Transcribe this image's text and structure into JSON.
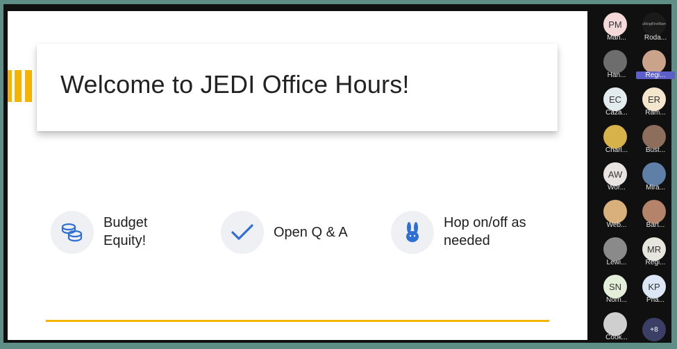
{
  "slide": {
    "title": "Welcome to JEDI Office Hours!",
    "features": [
      {
        "icon": "coins-icon",
        "label_line1": "Budget",
        "label_line2": "Equity!"
      },
      {
        "icon": "checkmark-icon",
        "label": "Open Q & A"
      },
      {
        "icon": "bunny-icon",
        "label_line1": "Hop on/off as",
        "label_line2": "needed"
      }
    ]
  },
  "participants": [
    {
      "initials": "PM",
      "name": "Man...",
      "bg": "#f3d9d9"
    },
    {
      "initials": "YuKingtFirstName",
      "name": "Roda...",
      "bg": "#1a1a1a"
    },
    {
      "initials": "",
      "name": "Han...",
      "bg": "#6d6d6d"
    },
    {
      "initials": "",
      "name": "Regi...",
      "bg": "#c9a48a",
      "highlight": true
    },
    {
      "initials": "EC",
      "name": "Caza...",
      "bg": "#e2ecef"
    },
    {
      "initials": "ER",
      "name": "Ram...",
      "bg": "#f4e6cc"
    },
    {
      "initials": "",
      "name": "Charl...",
      "bg": "#d7b24a"
    },
    {
      "initials": "",
      "name": "Bust...",
      "bg": "#8d6e5c"
    },
    {
      "initials": "AW",
      "name": "Wor...",
      "bg": "#e9e3e1"
    },
    {
      "initials": "",
      "name": "Mira...",
      "bg": "#5f7fa6"
    },
    {
      "initials": "",
      "name": "Web...",
      "bg": "#d9b07c"
    },
    {
      "initials": "",
      "name": "Bart...",
      "bg": "#b4836a"
    },
    {
      "initials": "",
      "name": "Lewi...",
      "bg": "#8a8a8a"
    },
    {
      "initials": "MR",
      "name": "Regi...",
      "bg": "#e6e6df"
    },
    {
      "initials": "SN",
      "name": "Norri...",
      "bg": "#e3efd9"
    },
    {
      "initials": "KP",
      "name": "Pha...",
      "bg": "#dde6f4"
    },
    {
      "initials": "",
      "name": "Cook...",
      "bg": "#cfcfcf"
    },
    {
      "initials": "+8",
      "name": "",
      "bg": "#3b3f66"
    }
  ],
  "colors": {
    "accent_yellow": "#f4b400",
    "icon_blue": "#2f6fd1",
    "frame_teal": "#5f8e86"
  }
}
